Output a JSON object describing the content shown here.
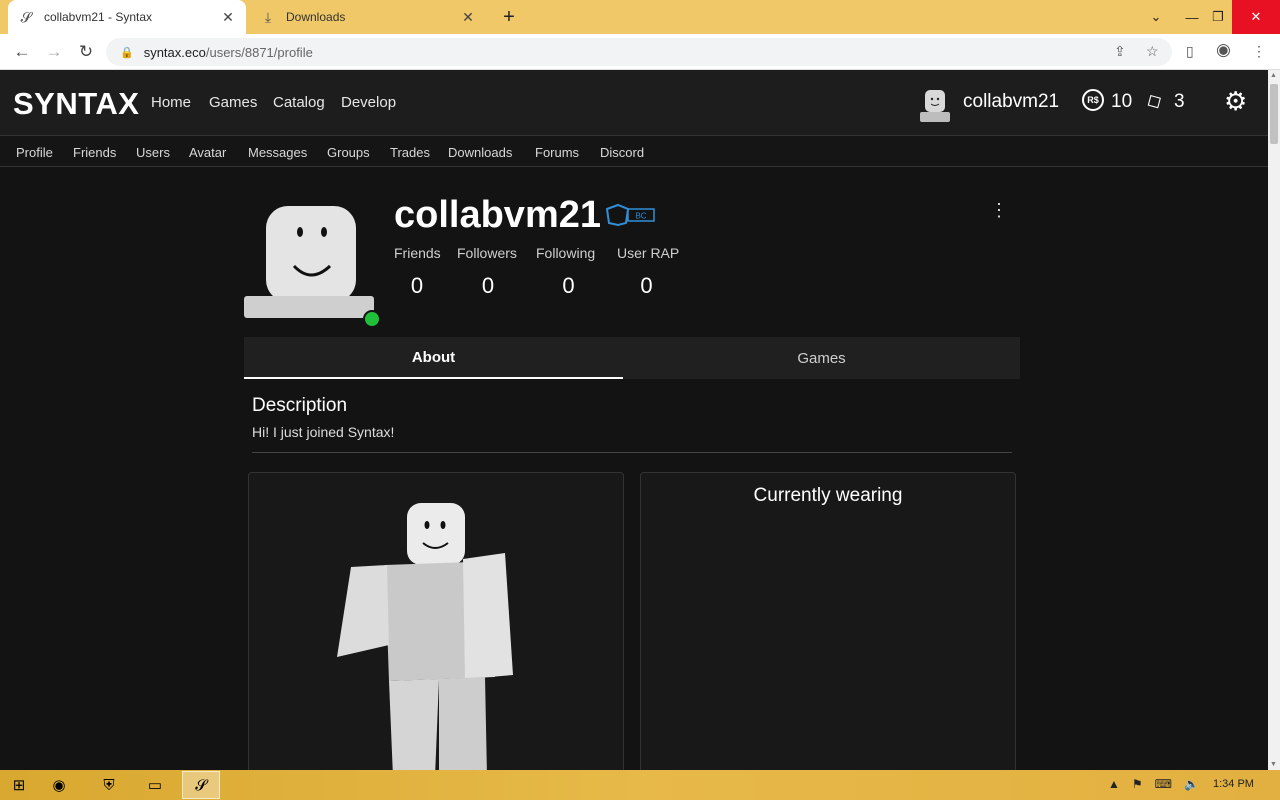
{
  "browser": {
    "tabs": [
      {
        "title": "collabvm21 - Syntax",
        "icon": "syntax-favicon-icon"
      },
      {
        "title": "Downloads",
        "icon": "download-icon"
      }
    ],
    "address": {
      "host": "syntax.eco",
      "path": "/users/8871/profile"
    }
  },
  "header": {
    "logo": "SYNTAX",
    "nav": [
      "Home",
      "Games",
      "Catalog",
      "Develop"
    ],
    "username": "collabvm21",
    "robux_icon_text": "R$",
    "robux": "10",
    "tickets": "3"
  },
  "subnav": [
    "Profile",
    "Friends",
    "Users",
    "Avatar",
    "Messages",
    "Groups",
    "Trades",
    "Downloads",
    "Forums",
    "Discord"
  ],
  "profile": {
    "name": "collabvm21",
    "badge_text": "BC",
    "stats": [
      {
        "label": "Friends",
        "value": "0"
      },
      {
        "label": "Followers",
        "value": "0"
      },
      {
        "label": "Following",
        "value": "0"
      },
      {
        "label": "User RAP",
        "value": "0"
      }
    ],
    "tabs": [
      "About",
      "Games"
    ],
    "description_title": "Description",
    "description": "Hi! I just joined Syntax!",
    "wearing_title": "Currently wearing"
  },
  "taskbar": {
    "time": "1:34 PM"
  },
  "colors": {
    "online": "#1fbf3a",
    "accent_tab": "#ffffff",
    "badge": "#2f8fd8"
  }
}
